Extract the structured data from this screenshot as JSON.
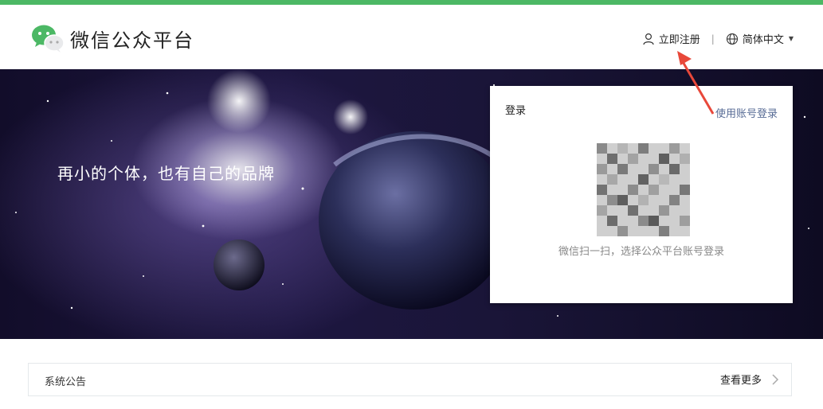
{
  "header": {
    "brand": "微信公众平台",
    "register_label": "立即注册",
    "separator": "|",
    "language_label": "简体中文"
  },
  "hero": {
    "slogan": "再小的个体，也有自己的品牌"
  },
  "login": {
    "title": "登录",
    "alt_login_label": "使用账号登录",
    "qr_tip": "微信扫一扫，选择公众平台账号登录"
  },
  "notice": {
    "title": "系统公告",
    "more_label": "查看更多"
  },
  "colors": {
    "brand_green": "#4cb865",
    "link_blue": "#576b95",
    "annotation_red": "#e8483a"
  },
  "icons": {
    "logo": "wechat-logo-icon",
    "register": "user-icon",
    "language": "globe-icon",
    "caret": "caret-down-icon",
    "more": "chevron-right-icon"
  }
}
